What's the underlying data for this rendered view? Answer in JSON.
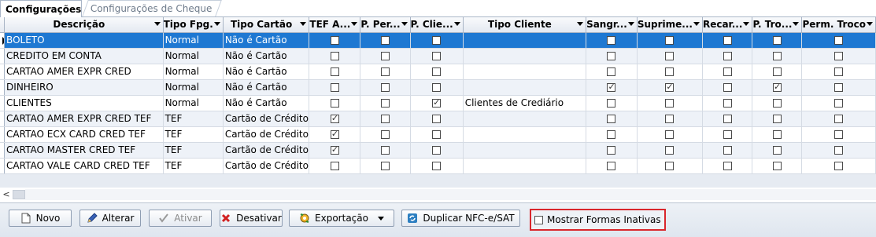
{
  "tabs": [
    {
      "label": "Configurações",
      "active": true
    },
    {
      "label": "Configurações de Cheque",
      "active": false
    }
  ],
  "grid": {
    "columns": [
      {
        "label": "Descrição"
      },
      {
        "label": "Tipo Fpg."
      },
      {
        "label": "Tipo Cartão"
      },
      {
        "label": "TEF A..."
      },
      {
        "label": "P. Per..."
      },
      {
        "label": "P. Clie..."
      },
      {
        "label": "Tipo Cliente"
      },
      {
        "label": "Sangr..."
      },
      {
        "label": "Suprime..."
      },
      {
        "label": "Recar..."
      },
      {
        "label": "P. Tro..."
      },
      {
        "label": "Perm. Troco"
      }
    ],
    "rows": [
      {
        "descricao": "BOLETO",
        "tipo_fpg": "Normal",
        "tipo_cartao": "Não é Cartão",
        "tef": false,
        "p_per": false,
        "p_cli": false,
        "tipo_cliente": "",
        "sangria": false,
        "suprimento": false,
        "recarga": false,
        "p_troco": false,
        "perm_troco": false,
        "selected": true
      },
      {
        "descricao": "CREDITO EM CONTA",
        "tipo_fpg": "Normal",
        "tipo_cartao": "Não é Cartão",
        "tef": false,
        "p_per": false,
        "p_cli": false,
        "tipo_cliente": "",
        "sangria": false,
        "suprimento": false,
        "recarga": false,
        "p_troco": false,
        "perm_troco": false
      },
      {
        "descricao": "CARTAO AMER EXPR CRED",
        "tipo_fpg": "Normal",
        "tipo_cartao": "Não é Cartão",
        "tef": false,
        "p_per": false,
        "p_cli": false,
        "tipo_cliente": "",
        "sangria": false,
        "suprimento": false,
        "recarga": false,
        "p_troco": false,
        "perm_troco": false
      },
      {
        "descricao": "DINHEIRO",
        "tipo_fpg": "Normal",
        "tipo_cartao": "Não é Cartão",
        "tef": false,
        "p_per": false,
        "p_cli": false,
        "tipo_cliente": "",
        "sangria": true,
        "suprimento": true,
        "recarga": false,
        "p_troco": true,
        "perm_troco": false
      },
      {
        "descricao": "CLIENTES",
        "tipo_fpg": "Normal",
        "tipo_cartao": "Não é Cartão",
        "tef": false,
        "p_per": false,
        "p_cli": true,
        "tipo_cliente": "Clientes de Crediário",
        "sangria": false,
        "suprimento": false,
        "recarga": false,
        "p_troco": false,
        "perm_troco": false
      },
      {
        "descricao": "CARTAO AMER EXPR CRED TEF",
        "tipo_fpg": "TEF",
        "tipo_cartao": "Cartão de Crédito",
        "tef": true,
        "p_per": false,
        "p_cli": false,
        "tipo_cliente": "",
        "sangria": false,
        "suprimento": false,
        "recarga": false,
        "p_troco": false,
        "perm_troco": false
      },
      {
        "descricao": "CARTAO ECX CARD CRED TEF",
        "tipo_fpg": "TEF",
        "tipo_cartao": "Cartão de Crédito",
        "tef": true,
        "p_per": false,
        "p_cli": false,
        "tipo_cliente": "",
        "sangria": false,
        "suprimento": false,
        "recarga": false,
        "p_troco": false,
        "perm_troco": false
      },
      {
        "descricao": "CARTAO MASTER CRED TEF",
        "tipo_fpg": "TEF",
        "tipo_cartao": "Cartão de Crédito",
        "tef": true,
        "p_per": false,
        "p_cli": false,
        "tipo_cliente": "",
        "sangria": false,
        "suprimento": false,
        "recarga": false,
        "p_troco": false,
        "perm_troco": false
      },
      {
        "descricao": "CARTAO VALE CARD CRED TEF",
        "tipo_fpg": "TEF",
        "tipo_cartao": "Cartão de Crédito",
        "tef": false,
        "p_per": false,
        "p_cli": false,
        "tipo_cliente": "",
        "sangria": false,
        "suprimento": false,
        "recarga": false,
        "p_troco": false,
        "perm_troco": false
      }
    ]
  },
  "toolbar": {
    "novo": "Novo",
    "alterar": "Alterar",
    "ativar": "Ativar",
    "desativar": "Desativar",
    "exportacao": "Exportação",
    "duplicar": "Duplicar NFC-e/SAT",
    "mostrar_inativas": "Mostrar Formas Inativas",
    "mostrar_inativas_checked": false
  },
  "icons": {
    "novo": "new-document-icon",
    "alterar": "edit-pencil-icon",
    "ativar": "checkmark-icon",
    "desativar": "red-x-icon",
    "exportacao": "export-gear-icon",
    "duplicar": "duplicate-refresh-icon"
  },
  "colors": {
    "selected_row": "#1e78d2",
    "alt_row": "#eef2f8",
    "highlight_border": "#d9262c"
  }
}
